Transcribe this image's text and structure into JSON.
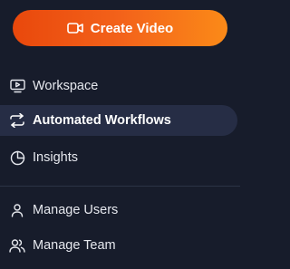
{
  "create_button": {
    "label": "Create Video",
    "icon": "video-camera-icon"
  },
  "nav": {
    "primary": [
      {
        "label": "Workspace",
        "icon": "monitor-play-icon",
        "active": false
      },
      {
        "label": "Automated Workflows",
        "icon": "arrows-repeat-icon",
        "active": true
      },
      {
        "label": "Insights",
        "icon": "pie-chart-icon",
        "active": false
      }
    ],
    "secondary": [
      {
        "label": "Manage Users",
        "icon": "user-icon",
        "active": false
      },
      {
        "label": "Manage Team",
        "icon": "users-icon",
        "active": false
      }
    ]
  },
  "colors": {
    "background": "#171c2b",
    "accent_gradient_start": "#e9480c",
    "accent_gradient_end": "#fb8a18",
    "active_item_bg": "#262d45",
    "divider": "#2c3346"
  }
}
